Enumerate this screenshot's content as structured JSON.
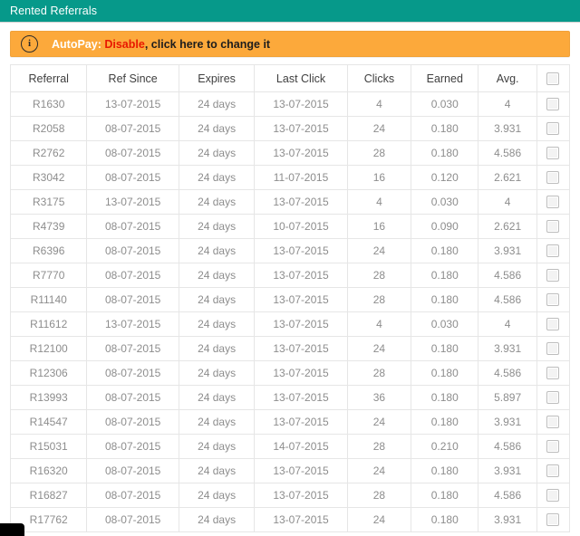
{
  "titlebar": {
    "title": "Rented Referrals",
    "bg_color": "#06998a"
  },
  "alert": {
    "icon": "info-circle-icon",
    "icon_glyph": "i",
    "label": "AutoPay:",
    "state": "Disable",
    "separator": ",",
    "hint": "click here to change it",
    "bg_color": "#fca93b",
    "state_color": "#e81800"
  },
  "table": {
    "columns": [
      "Referral",
      "Ref Since",
      "Expires",
      "Last Click",
      "Clicks",
      "Earned",
      "Avg.",
      ""
    ],
    "select_all_checkbox": "unchecked",
    "rows": [
      {
        "referral": "R1630",
        "ref_since": "13-07-2015",
        "expires": "24 days",
        "last_click": "13-07-2015",
        "clicks": "4",
        "earned": "0.030",
        "avg": "4",
        "checked": false
      },
      {
        "referral": "R2058",
        "ref_since": "08-07-2015",
        "expires": "24 days",
        "last_click": "13-07-2015",
        "clicks": "24",
        "earned": "0.180",
        "avg": "3.931",
        "checked": false
      },
      {
        "referral": "R2762",
        "ref_since": "08-07-2015",
        "expires": "24 days",
        "last_click": "13-07-2015",
        "clicks": "28",
        "earned": "0.180",
        "avg": "4.586",
        "checked": false
      },
      {
        "referral": "R3042",
        "ref_since": "08-07-2015",
        "expires": "24 days",
        "last_click": "11-07-2015",
        "clicks": "16",
        "earned": "0.120",
        "avg": "2.621",
        "checked": false
      },
      {
        "referral": "R3175",
        "ref_since": "13-07-2015",
        "expires": "24 days",
        "last_click": "13-07-2015",
        "clicks": "4",
        "earned": "0.030",
        "avg": "4",
        "checked": false
      },
      {
        "referral": "R4739",
        "ref_since": "08-07-2015",
        "expires": "24 days",
        "last_click": "10-07-2015",
        "clicks": "16",
        "earned": "0.090",
        "avg": "2.621",
        "checked": false
      },
      {
        "referral": "R6396",
        "ref_since": "08-07-2015",
        "expires": "24 days",
        "last_click": "13-07-2015",
        "clicks": "24",
        "earned": "0.180",
        "avg": "3.931",
        "checked": false
      },
      {
        "referral": "R7770",
        "ref_since": "08-07-2015",
        "expires": "24 days",
        "last_click": "13-07-2015",
        "clicks": "28",
        "earned": "0.180",
        "avg": "4.586",
        "checked": false
      },
      {
        "referral": "R11140",
        "ref_since": "08-07-2015",
        "expires": "24 days",
        "last_click": "13-07-2015",
        "clicks": "28",
        "earned": "0.180",
        "avg": "4.586",
        "checked": false
      },
      {
        "referral": "R11612",
        "ref_since": "13-07-2015",
        "expires": "24 days",
        "last_click": "13-07-2015",
        "clicks": "4",
        "earned": "0.030",
        "avg": "4",
        "checked": false
      },
      {
        "referral": "R12100",
        "ref_since": "08-07-2015",
        "expires": "24 days",
        "last_click": "13-07-2015",
        "clicks": "24",
        "earned": "0.180",
        "avg": "3.931",
        "checked": false
      },
      {
        "referral": "R12306",
        "ref_since": "08-07-2015",
        "expires": "24 days",
        "last_click": "13-07-2015",
        "clicks": "28",
        "earned": "0.180",
        "avg": "4.586",
        "checked": false
      },
      {
        "referral": "R13993",
        "ref_since": "08-07-2015",
        "expires": "24 days",
        "last_click": "13-07-2015",
        "clicks": "36",
        "earned": "0.180",
        "avg": "5.897",
        "checked": false
      },
      {
        "referral": "R14547",
        "ref_since": "08-07-2015",
        "expires": "24 days",
        "last_click": "13-07-2015",
        "clicks": "24",
        "earned": "0.180",
        "avg": "3.931",
        "checked": false
      },
      {
        "referral": "R15031",
        "ref_since": "08-07-2015",
        "expires": "24 days",
        "last_click": "14-07-2015",
        "clicks": "28",
        "earned": "0.210",
        "avg": "4.586",
        "checked": false
      },
      {
        "referral": "R16320",
        "ref_since": "08-07-2015",
        "expires": "24 days",
        "last_click": "13-07-2015",
        "clicks": "24",
        "earned": "0.180",
        "avg": "3.931",
        "checked": false
      },
      {
        "referral": "R16827",
        "ref_since": "08-07-2015",
        "expires": "24 days",
        "last_click": "13-07-2015",
        "clicks": "28",
        "earned": "0.180",
        "avg": "4.586",
        "checked": false
      },
      {
        "referral": "R17762",
        "ref_since": "08-07-2015",
        "expires": "24 days",
        "last_click": "13-07-2015",
        "clicks": "24",
        "earned": "0.180",
        "avg": "3.931",
        "checked": false
      }
    ]
  }
}
